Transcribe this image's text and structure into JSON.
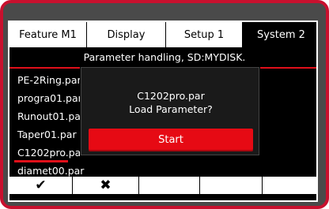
{
  "tabs": [
    {
      "label": "Feature  M1"
    },
    {
      "label": "Display"
    },
    {
      "label": "Setup 1"
    },
    {
      "label": "System 2"
    }
  ],
  "title": "Parameter handling, SD:MYDISK.",
  "files": [
    "PE-2Ring.par",
    "progra01.par",
    "Runout01.par",
    "Taper01.par",
    "C1202pro.par",
    "diamet00.par"
  ],
  "selected_file_index": 4,
  "dialog": {
    "filename": "C1202pro.par",
    "question": "Load Parameter?",
    "start_label": "Start"
  },
  "softkeys": [
    {
      "icon": "check-icon",
      "glyph": "✔"
    },
    {
      "icon": "cross-icon",
      "glyph": "✖"
    },
    {
      "icon": "",
      "glyph": ""
    },
    {
      "icon": "",
      "glyph": ""
    },
    {
      "icon": "",
      "glyph": ""
    }
  ],
  "colors": {
    "accent": "#e0101a",
    "button": "#e60a14",
    "bezel": "#4a4a4a",
    "frame": "#c8102e"
  }
}
